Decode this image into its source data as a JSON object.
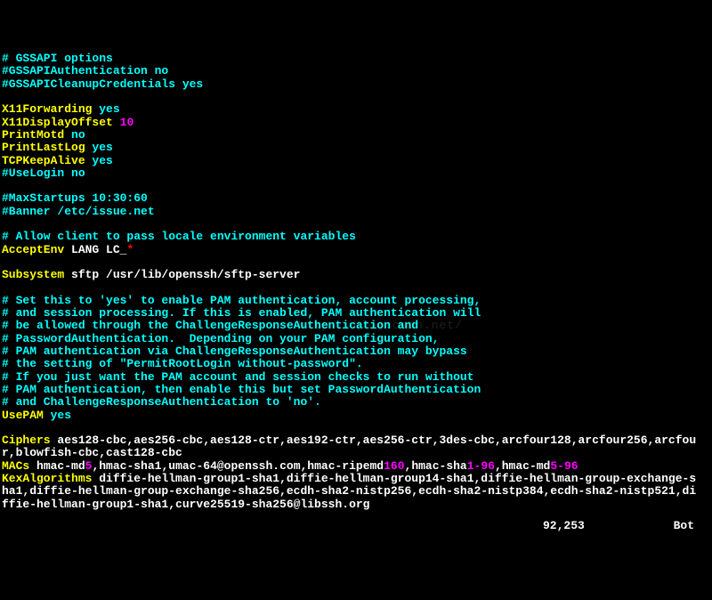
{
  "lines": [
    [
      [
        "cyan",
        "# GSSAPI options"
      ]
    ],
    [
      [
        "cyan",
        "#GSSAPIAuthentication no"
      ]
    ],
    [
      [
        "cyan",
        "#GSSAPICleanupCredentials yes"
      ]
    ],
    [
      [
        "",
        ""
      ]
    ],
    [
      [
        "yellow",
        "X11Forwarding"
      ],
      [
        "cyan",
        " yes"
      ]
    ],
    [
      [
        "yellow",
        "X11DisplayOffset"
      ],
      [
        "white",
        " "
      ],
      [
        "magenta",
        "10"
      ]
    ],
    [
      [
        "yellow",
        "PrintMotd"
      ],
      [
        "cyan",
        " no"
      ]
    ],
    [
      [
        "yellow",
        "PrintLastLog"
      ],
      [
        "cyan",
        " yes"
      ]
    ],
    [
      [
        "yellow",
        "TCPKeepAlive"
      ],
      [
        "cyan",
        " yes"
      ]
    ],
    [
      [
        "cyan",
        "#UseLogin no"
      ]
    ],
    [
      [
        "",
        ""
      ]
    ],
    [
      [
        "cyan",
        "#MaxStartups 10:30:60"
      ]
    ],
    [
      [
        "cyan",
        "#Banner /etc/issue.net"
      ]
    ],
    [
      [
        "",
        ""
      ]
    ],
    [
      [
        "cyan",
        "# Allow client to pass locale environment variables"
      ]
    ],
    [
      [
        "yellow",
        "AcceptEnv"
      ],
      [
        "white",
        " LANG LC_"
      ],
      [
        "red",
        "*"
      ]
    ],
    [
      [
        "",
        ""
      ]
    ],
    [
      [
        "yellow",
        "Subsystem"
      ],
      [
        "white",
        " sftp /usr/lib/openssh/sftp-server"
      ]
    ],
    [
      [
        "",
        ""
      ]
    ],
    [
      [
        "cyan",
        "# Set this to 'yes' to enable PAM authentication, account processing,"
      ]
    ],
    [
      [
        "cyan",
        "# and session processing. If this is enabled, PAM authentication will"
      ]
    ],
    [
      [
        "cyan",
        "# be allowed through the ChallengeResponseAuthentication and"
      ]
    ],
    [
      [
        "cyan",
        "# PasswordAuthentication.  Depending on your PAM configuration,"
      ]
    ],
    [
      [
        "cyan",
        "# PAM authentication via ChallengeResponseAuthentication may bypass"
      ]
    ],
    [
      [
        "cyan",
        "# the setting of \"PermitRootLogin without-password\"."
      ]
    ],
    [
      [
        "cyan",
        "# If you just want the PAM account and session checks to run without"
      ]
    ],
    [
      [
        "cyan",
        "# PAM authentication, then enable this but set PasswordAuthentication"
      ]
    ],
    [
      [
        "cyan",
        "# and ChallengeResponseAuthentication to 'no'."
      ]
    ],
    [
      [
        "yellow",
        "UsePAM"
      ],
      [
        "cyan",
        " yes"
      ]
    ],
    [
      [
        "",
        ""
      ]
    ],
    [
      [
        "yellow",
        "Ciphers"
      ],
      [
        "white",
        " aes128-cbc,aes256-cbc,aes128-ctr,aes192-ctr,aes256-ctr,3des-cbc,arcfour128,arcfour256,arcfou"
      ]
    ],
    [
      [
        "white",
        "r,blowfish-cbc,cast128-cbc"
      ]
    ],
    [
      [
        "yellow",
        "MACs"
      ],
      [
        "white",
        " hmac-md"
      ],
      [
        "magenta",
        "5"
      ],
      [
        "white",
        ",hmac-sha1,umac-64@openssh.com,hmac-ripemd"
      ],
      [
        "magenta",
        "160"
      ],
      [
        "white",
        ",hmac-sha"
      ],
      [
        "magenta",
        "1-96"
      ],
      [
        "white",
        ",hmac-md"
      ],
      [
        "magenta",
        "5-96"
      ]
    ],
    [
      [
        "yellow",
        "KexAlgorithms"
      ],
      [
        "white",
        " diffie-hellman-group1-sha1,diffie-hellman-group14-sha1,diffie-hellman-group-exchange-s"
      ]
    ],
    [
      [
        "white",
        "ha1,diffie-hellman-group-exchange-sha256,ecdh-sha2-nistp256,ecdh-sha2-nistp384,ecdh-sha2-nistp521,di"
      ]
    ],
    [
      [
        "white",
        "ffie-hellman-group1-sha1,curve25519-sha256@libssh.org"
      ]
    ]
  ],
  "status": {
    "pos": "92,253",
    "pct": "Bot"
  },
  "watermark": "http://blog.csdn.net/"
}
